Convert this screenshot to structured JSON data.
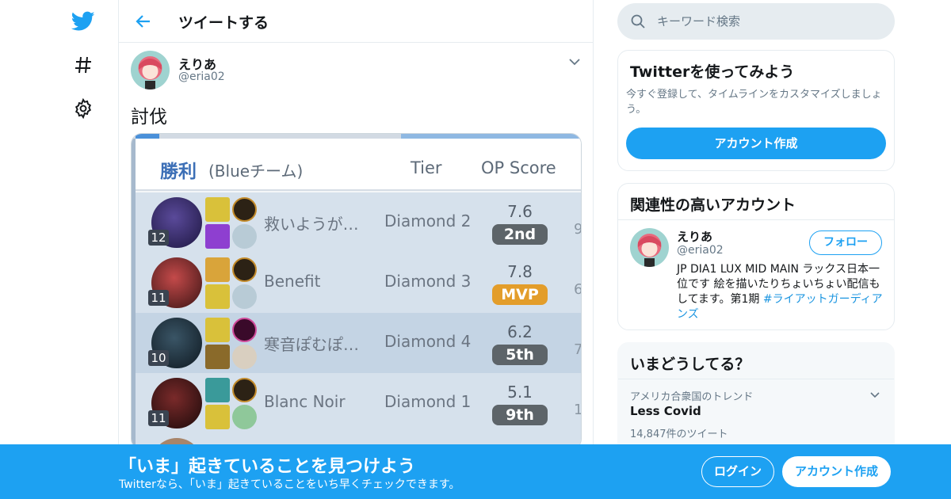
{
  "nav": {
    "icons": [
      "twitter-bird-icon",
      "hashtag-icon",
      "gear-icon"
    ]
  },
  "header": {
    "title": "ツイートする",
    "back_icon": "arrow-left-icon"
  },
  "tweet": {
    "author_name": "えりあ",
    "author_handle": "@eria02",
    "text": "討伐",
    "menu_icon": "chevron-down-icon",
    "media": {
      "result_label": "勝利",
      "team_label": "(Blueチーム)",
      "col_tier": "Tier",
      "col_op": "OP Score",
      "rows": [
        {
          "level": "12",
          "name": "救いようが…",
          "tier": "Diamond 2",
          "score": "7.6",
          "rank": "2nd",
          "edge": "9"
        },
        {
          "level": "11",
          "name": "Benefit",
          "tier": "Diamond 3",
          "score": "7.8",
          "rank": "MVP",
          "edge": "6"
        },
        {
          "level": "10",
          "name": "寒音ぽむぽ…",
          "tier": "Diamond 4",
          "score": "6.2",
          "rank": "5th",
          "edge": "7"
        },
        {
          "level": "11",
          "name": "Blanc Noir",
          "tier": "Diamond 1",
          "score": "5.1",
          "rank": "9th",
          "edge": "1"
        }
      ]
    }
  },
  "search": {
    "placeholder": "キーワード検索",
    "icon": "search-icon"
  },
  "signup_card": {
    "title": "Twitterを使ってみよう",
    "description": "今すぐ登録して、タイムラインをカスタマイズしましょう。",
    "button": "アカウント作成"
  },
  "related_card": {
    "title": "関連性の高いアカウント",
    "name": "えりあ",
    "handle": "@eria02",
    "follow_label": "フォロー",
    "bio_text": "JP DIA1 LUX MID MAIN ラックス日本一位です 絵を描いたりちょいちょい配信もしてます。第1期 ",
    "bio_hashtag": "#ライアットガーディアンズ"
  },
  "trends_card": {
    "title": "いまどうしてる？",
    "context": "アメリカ合衆国のトレンド",
    "trend_name": "Less Covid",
    "trend_count": "14,847件のツイート"
  },
  "banner": {
    "title": "「いま」起きていることを見つけよう",
    "subtitle": "Twitterなら、「いま」起きていることをいち早くチェックできます。",
    "login_label": "ログイン",
    "signup_label": "アカウント作成"
  },
  "colors": {
    "brand_blue": "#1da1f2",
    "mvp_gold": "#e39d2a",
    "rank_gray": "#5d6469"
  }
}
